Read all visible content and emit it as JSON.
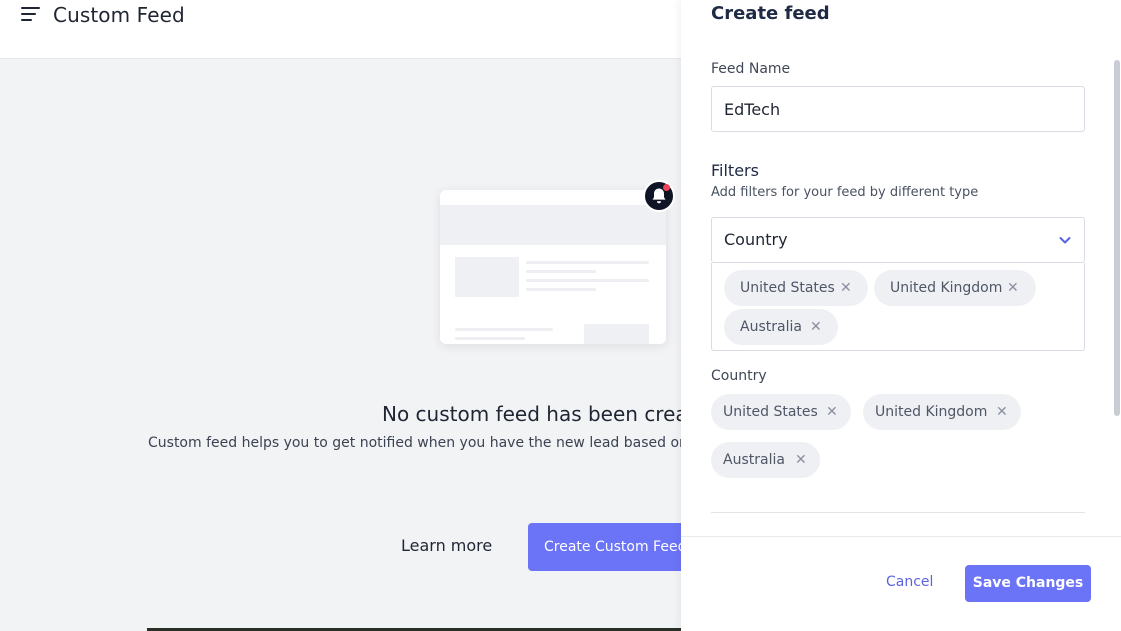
{
  "header": {
    "title": "Custom Feed"
  },
  "empty_state": {
    "title": "No custom feed has been created yet",
    "description": "Custom feed helps you to get notified when you have the new lead based on your filters",
    "learn_more_label": "Learn more",
    "create_button_label": "Create Custom Feed"
  },
  "drawer": {
    "title": "Create feed",
    "feed_name_label": "Feed Name",
    "feed_name_value": "EdTech",
    "filters_title": "Filters",
    "filters_subtitle": "Add filters for your feed by different type",
    "filter_select_value": "Country",
    "selected_tags": [
      "United States",
      "United Kingdom",
      "Australia"
    ],
    "summary_label": "Country",
    "summary_tags": [
      "United States",
      "United Kingdom",
      "Australia"
    ],
    "cancel_label": "Cancel",
    "save_label": "Save Changes",
    "remove_glyph": "✕"
  },
  "colors": {
    "accent": "#6b74f7",
    "page_bg": "#f2f3f5",
    "chip_bg": "#eef0f4"
  },
  "icons": [
    "menu-icon",
    "bell-icon",
    "chevron-down-icon",
    "close-icon"
  ]
}
